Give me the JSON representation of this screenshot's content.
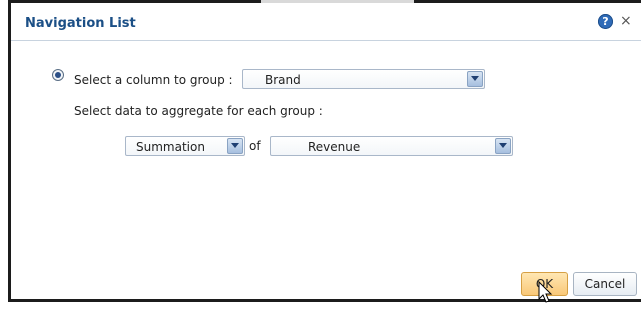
{
  "dialog": {
    "title": "Navigation List",
    "help_glyph": "?",
    "close_glyph": "×"
  },
  "group": {
    "radio_label": "Select a column to group :",
    "radio_selected": true,
    "column_value": "Brand"
  },
  "aggregate": {
    "label": "Select data to aggregate for each group :",
    "function_value": "Summation",
    "of_text": "of",
    "measure_value": "Revenue"
  },
  "buttons": {
    "ok_label": "OK",
    "cancel_label": "Cancel"
  },
  "colors": {
    "title": "#1b4f86",
    "ok_fill": "#f9c878",
    "accent": "#2f6bb8"
  },
  "icons": {
    "help": "help-icon",
    "close": "close-icon",
    "dropdown": "chevron-down-icon",
    "cursor": "mouse-pointer-icon"
  }
}
